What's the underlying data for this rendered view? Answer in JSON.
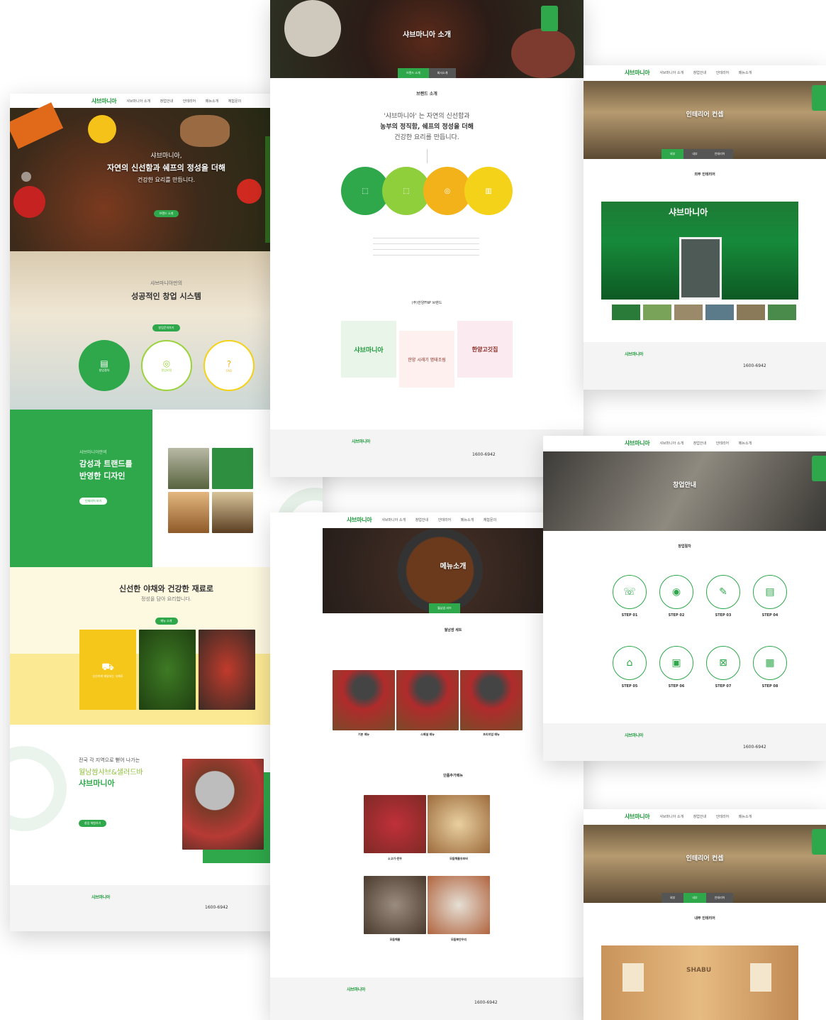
{
  "brand": {
    "logo": "샤브마니아",
    "phone": "1600-6942",
    "primary": "#2ea84a",
    "yellow": "#f6d21a"
  },
  "nav": [
    "샤브마니아 소개",
    "창업안내",
    "인테리어",
    "메뉴소개",
    "체험문의"
  ],
  "main": {
    "hero": {
      "line1": "샤브마니아,",
      "line2": "자연의 신선함과 쉐프의 정성을 더해",
      "line3": "건강한 요리를 만듭니다.",
      "btn": "브랜드 소개"
    },
    "startup": {
      "small": "샤브마니아만의",
      "title": "성공적인 창업 시스템",
      "btn": "창업문의하기",
      "circles": [
        "창업절차",
        "창업비용",
        "FAQ"
      ]
    },
    "design": {
      "small": "샤브마니아만의",
      "title1": "감성과 트랜드를",
      "title2": "반영한 디자인",
      "btn": "인테리어 보기"
    },
    "fresh": {
      "title": "신선한 야채와 건강한 재료로",
      "sub": "정성을 담아 요리합니다.",
      "btn": "메뉴 소개",
      "card": "신선하게 배달되는 식재료"
    },
    "nation": {
      "small": "전국 각 지역으로 뻗어 나가는",
      "title1": "월남쌈샤브&샐러드바",
      "title2": "샤브마니아",
      "btn": "창업 체험하기"
    }
  },
  "about": {
    "title": "샤브마니아 소개",
    "tabs": [
      "브랜드 소개",
      "회사소개"
    ],
    "section": "브랜드 소개",
    "quote1": "'샤브마니아' 는 자연의 신선함과",
    "quote2": "농부의 정직함, 쉐프의 정성을 더해",
    "quote3": "건강한 요리를 만듭니다.",
    "sub_brands": "(주)한양FNP 브랜드",
    "brand_logos": [
      "샤브마니아",
      "한양 시래기 명태조림",
      "한양고깃집"
    ]
  },
  "menu": {
    "title": "메뉴소개",
    "tab": "월남쌈 샤브",
    "section1": "월남쌈 세트",
    "section2": "단품추가메뉴",
    "sets": [
      "기본 메뉴",
      "스페셜 메뉴",
      "프리미엄 메뉴"
    ],
    "items": [
      "소고기·한우",
      "모듬해물유부바",
      "모듬해물",
      "모듬뽀얀우리"
    ]
  },
  "interior": {
    "title": "인테리어 컨셉",
    "tabs": [
      "외부",
      "내부",
      "인테리어"
    ],
    "section": "외부 인테리어",
    "sign": "샤브마니아"
  },
  "startup_page": {
    "title": "창업안내",
    "section": "창업절차",
    "steps": [
      {
        "label": "STEP 01",
        "icon": "☏"
      },
      {
        "label": "STEP 02",
        "icon": "◉"
      },
      {
        "label": "STEP 03",
        "icon": "✎"
      },
      {
        "label": "STEP 04",
        "icon": "▤"
      },
      {
        "label": "STEP 05",
        "icon": "⌂"
      },
      {
        "label": "STEP 06",
        "icon": "▣"
      },
      {
        "label": "STEP 07",
        "icon": "⊠"
      },
      {
        "label": "STEP 08",
        "icon": "▦"
      }
    ]
  },
  "interior2": {
    "title": "인테리어 컨셉",
    "section": "내부 인테리어",
    "wall_logo": "SHABU"
  }
}
